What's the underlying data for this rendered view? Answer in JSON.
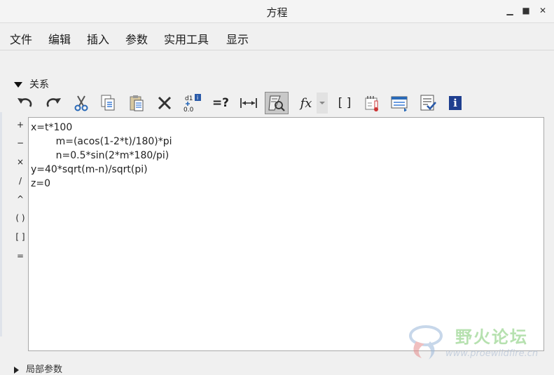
{
  "window": {
    "title": "方程"
  },
  "menu": [
    "文件",
    "编辑",
    "插入",
    "参数",
    "实用工具",
    "显示"
  ],
  "section": {
    "title": "关系"
  },
  "toolbar": {
    "active_index": 12,
    "buttons": [
      {
        "name": "undo-icon"
      },
      {
        "name": "redo-icon"
      },
      {
        "name": "cut-icon"
      },
      {
        "name": "copy-icon"
      },
      {
        "name": "paste-icon"
      },
      {
        "name": "delete-icon"
      },
      {
        "name": "insert-parameter-icon",
        "label_top": "d1",
        "label_bottom": "0.0"
      },
      {
        "name": "evaluate-icon",
        "label": "=?"
      },
      {
        "name": "dimension-icon"
      },
      {
        "name": "display-icon"
      },
      {
        "name": "function-icon",
        "label": "fx"
      },
      {
        "name": "function-dropdown-icon"
      },
      {
        "name": "brackets-icon",
        "label": "[ ]"
      },
      {
        "name": "units-icon"
      },
      {
        "name": "sort-icon"
      },
      {
        "name": "verify-icon"
      },
      {
        "name": "info-icon",
        "label": "i"
      }
    ]
  },
  "operators": [
    "+",
    "−",
    "×",
    "/",
    "^",
    "( )",
    "[ ]",
    "="
  ],
  "editor": {
    "lines": [
      "x=t*100",
      "        m=(acos(1-2*t)/180)*pi",
      "        n=0.5*sin(2*m*180/pi)",
      "y=40*sqrt(m-n)/sqrt(pi)",
      "z=0"
    ]
  },
  "watermark": {
    "text": "野火论坛",
    "url": "www.proewildfire.cn"
  },
  "bottom_section": {
    "title": "局部参数"
  }
}
